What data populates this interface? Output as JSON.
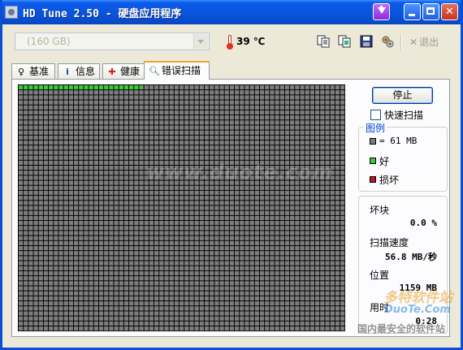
{
  "window": {
    "title": "HD Tune 2.50 - 硬盘应用程序"
  },
  "toolbar": {
    "drive": "(160 GB)",
    "temperature": "39 ℃",
    "exit_label": "退出",
    "icons": [
      "copy-text-icon",
      "copy-screen-icon",
      "save-icon",
      "options-icon",
      "exit-icon"
    ]
  },
  "tabs": [
    {
      "label": "基准",
      "icon": "benchmark-icon"
    },
    {
      "label": "信息",
      "icon": "info-icon"
    },
    {
      "label": "健康",
      "icon": "health-icon"
    },
    {
      "label": "错误扫描",
      "icon": "magnifier-icon",
      "active": true
    }
  ],
  "scan": {
    "progress_fraction": 0.38,
    "block_rows_done": 1
  },
  "controls": {
    "stop_label": "停止",
    "quick_scan_label": "快速扫描",
    "quick_scan_checked": false
  },
  "legend": {
    "title": "图例",
    "block_size": "= 61 MB",
    "ok_label": "好",
    "bad_label": "损坏",
    "colors": {
      "block": "#7e7e7e",
      "ok": "#3cc93c",
      "bad": "#c0161c"
    }
  },
  "stats": {
    "bad_blocks_label": "坏块",
    "bad_blocks_value": "0.0 %",
    "speed_label": "扫描速度",
    "speed_value": "56.8 MB/秒",
    "position_label": "位置",
    "position_value": "1159 MB",
    "elapsed_label": "用时",
    "elapsed_value": "0:28"
  },
  "watermarks": {
    "center": "www.duote.com",
    "logo_top": "多特软件站",
    "logo_url": "DuoTe.Com",
    "logo_bottom": "国内最安全的软件站"
  }
}
